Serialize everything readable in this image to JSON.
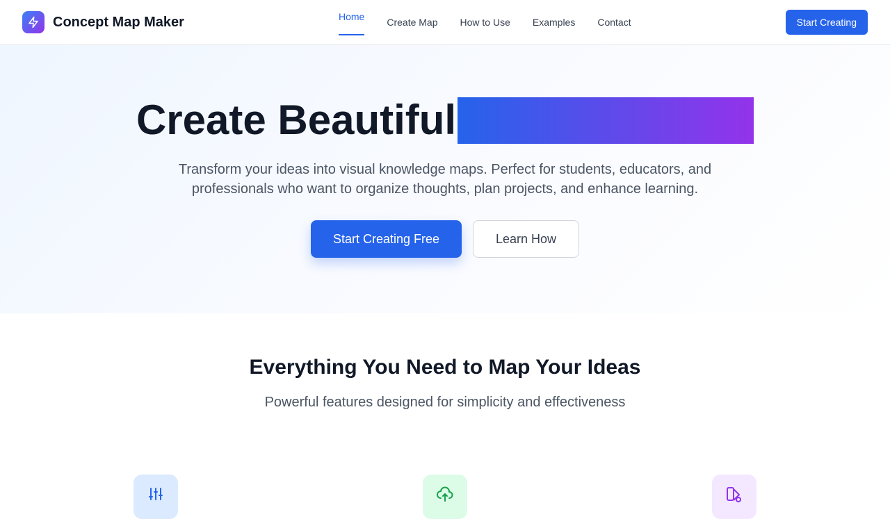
{
  "brand": {
    "name": "Concept Map Maker",
    "logo_icon": "bolt-icon"
  },
  "nav": {
    "items": [
      {
        "label": "Home",
        "active": true
      },
      {
        "label": "Create Map",
        "active": false
      },
      {
        "label": "How to Use",
        "active": false
      },
      {
        "label": "Examples",
        "active": false
      },
      {
        "label": "Contact",
        "active": false
      }
    ],
    "cta_label": "Start Creating"
  },
  "hero": {
    "title": "Create Beautiful",
    "subtitle": "Transform your ideas into visual knowledge maps. Perfect for students, educators, and professionals who want to organize thoughts, plan projects, and enhance learning.",
    "primary_label": "Start Creating Free",
    "secondary_label": "Learn How"
  },
  "features": {
    "title": "Everything You Need to Map Your Ideas",
    "subtitle": "Powerful features designed for simplicity and effectiveness",
    "icons": [
      {
        "icon": "sliders-icon",
        "bg": "#dbeafe",
        "color": "#2563eb"
      },
      {
        "icon": "cloud-icon",
        "bg": "#dcfce7",
        "color": "#16a34a"
      },
      {
        "icon": "shapes-icon",
        "bg": "#f3e8ff",
        "color": "#9333ea"
      }
    ]
  },
  "colors": {
    "accent": "#2563eb",
    "gradient_start": "#2563eb",
    "gradient_end": "#9333ea"
  }
}
